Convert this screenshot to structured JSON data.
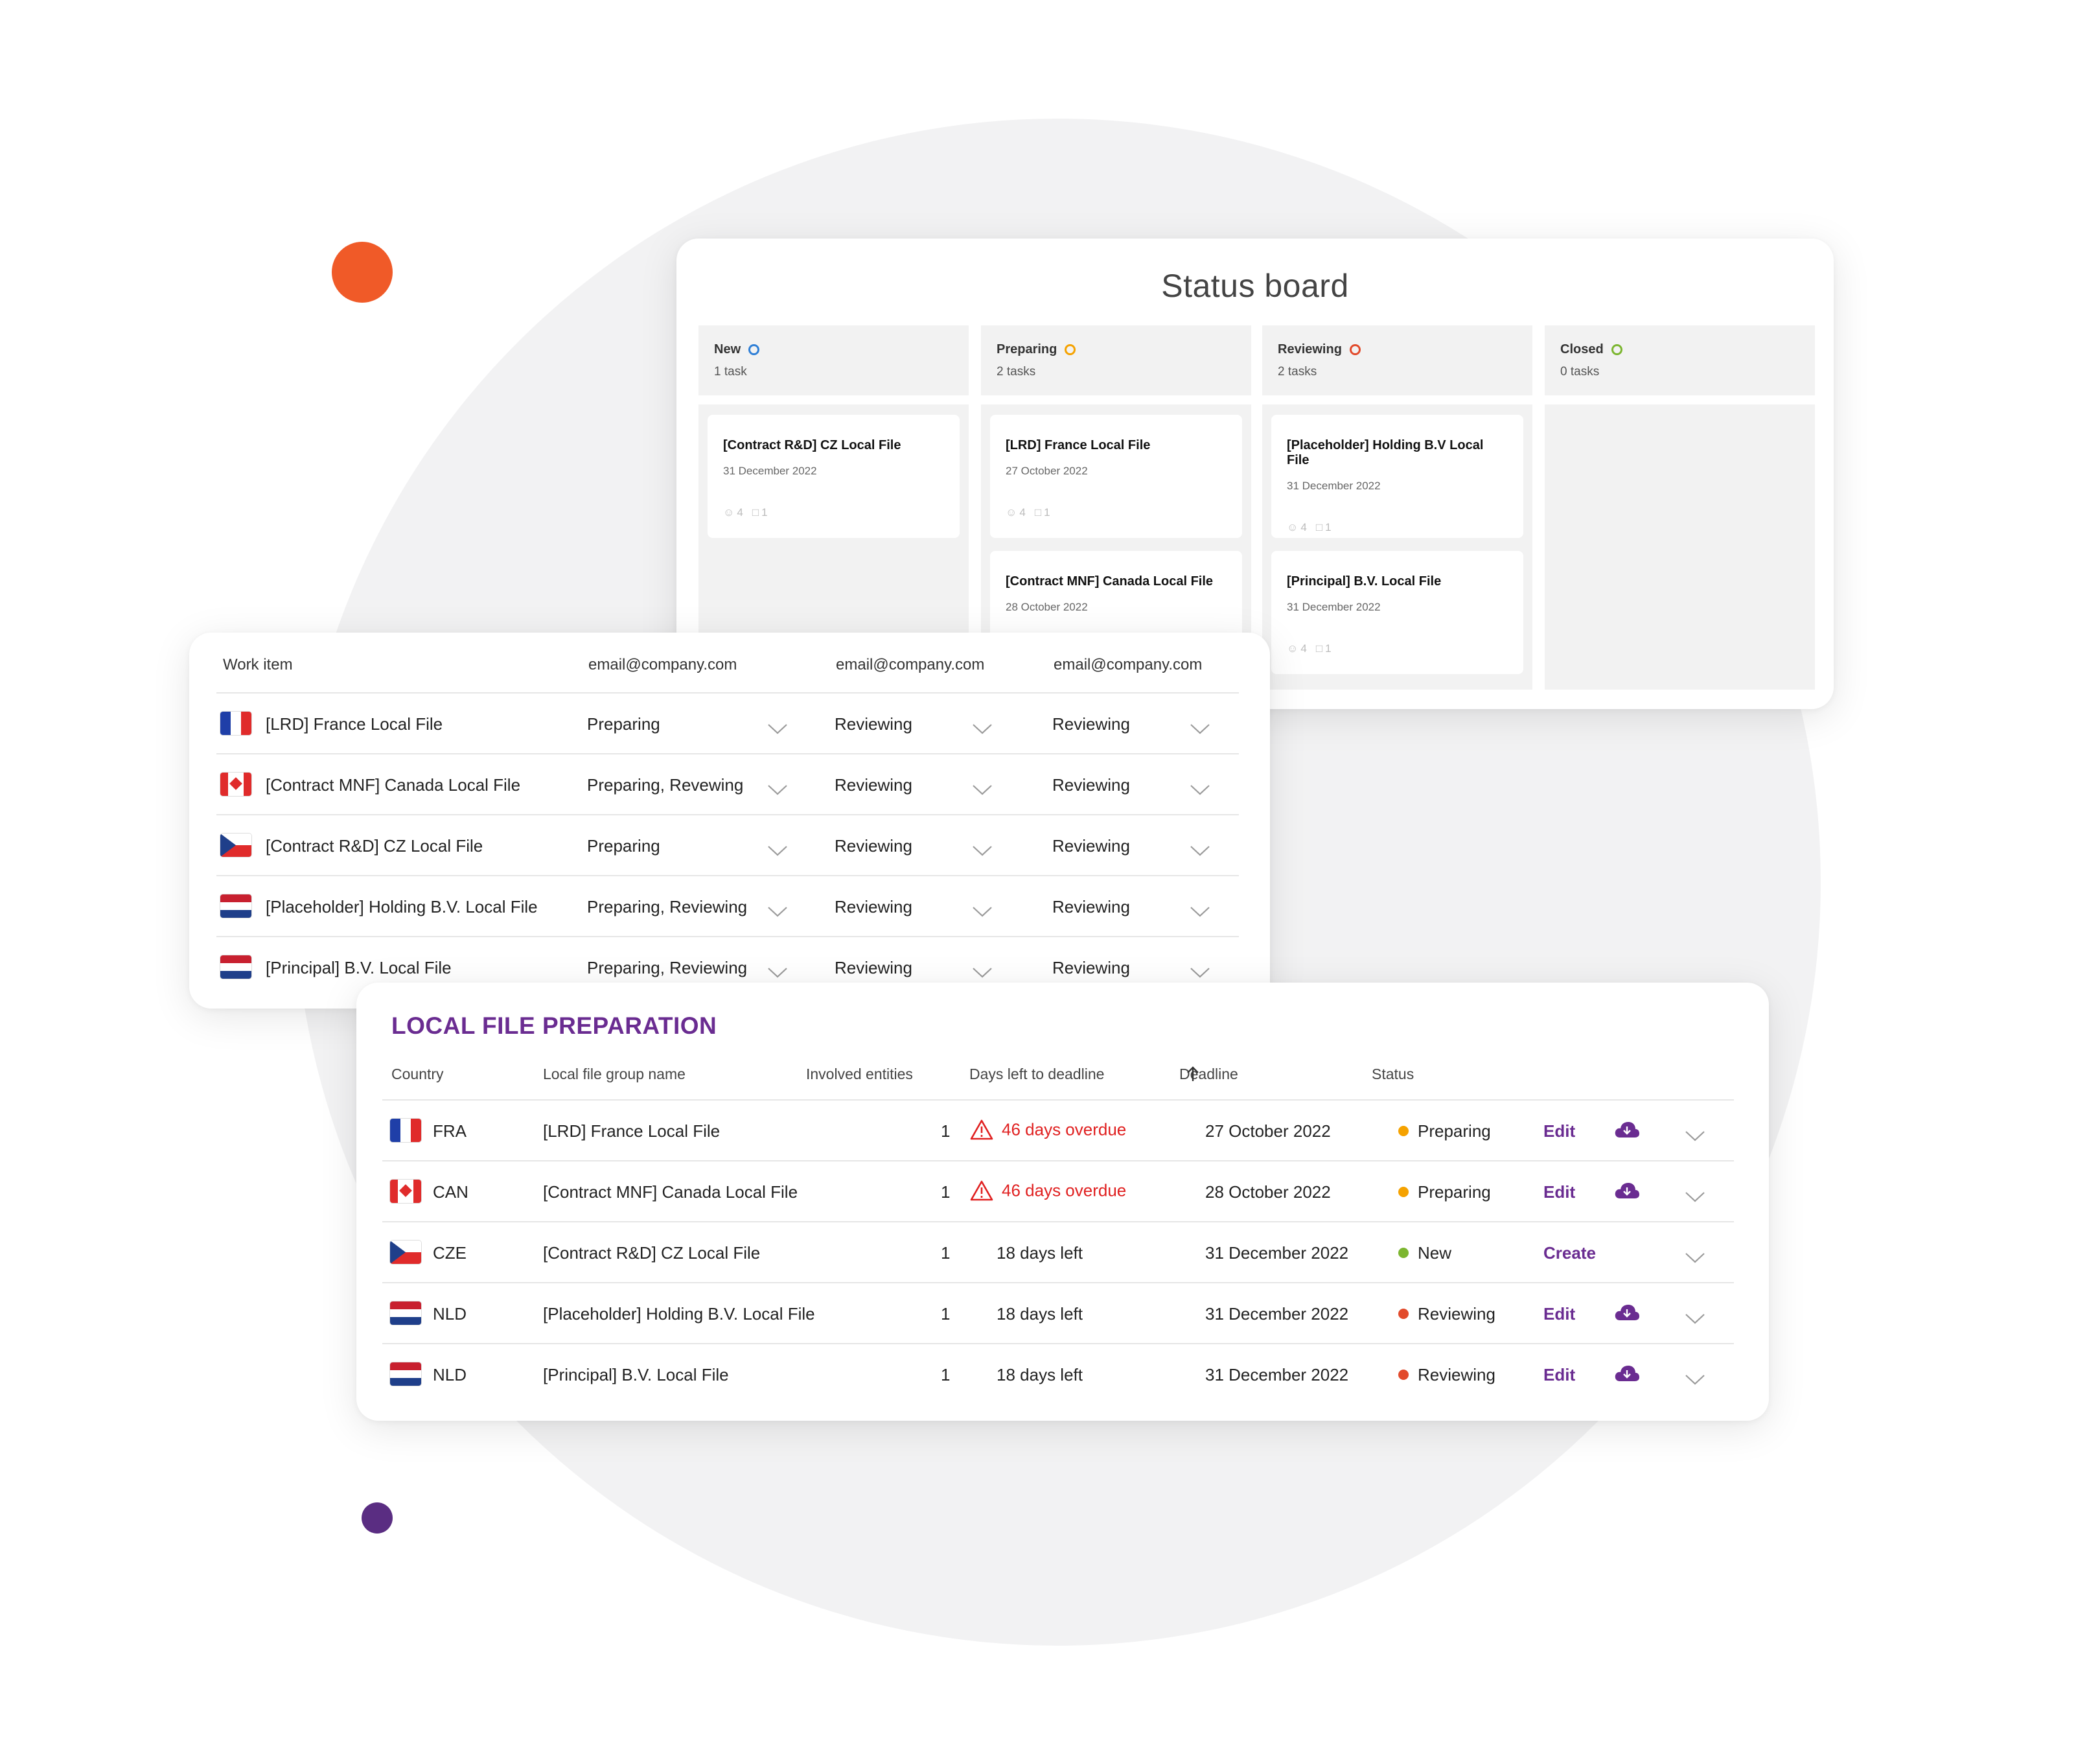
{
  "colors": {
    "accent_purple": "#6a2c91",
    "orange": "#f5a200",
    "red": "#e24a2b",
    "green": "#7cb630",
    "blue": "#2f7fd6",
    "overdue_red": "#e02020"
  },
  "status_board": {
    "title": "Status board",
    "columns": [
      {
        "name": "New",
        "count": "1 task",
        "ring_color": "#2f7fd6",
        "tasks": [
          {
            "title": "[Contract R&D] CZ Local File",
            "date": "31 December 2022",
            "people": "4",
            "files": "1"
          }
        ]
      },
      {
        "name": "Preparing",
        "count": "2 tasks",
        "ring_color": "#f5a200",
        "tasks": [
          {
            "title": "[LRD] France Local File",
            "date": "27 October 2022",
            "people": "4",
            "files": "1"
          },
          {
            "title": "[Contract MNF] Canada Local File",
            "date": "28 October 2022",
            "people": "",
            "files": ""
          }
        ]
      },
      {
        "name": "Reviewing",
        "count": "2 tasks",
        "ring_color": "#e24a2b",
        "tasks": [
          {
            "title": "[Placeholder] Holding B.V Local File",
            "date": "31 December 2022",
            "people": "4",
            "files": "1"
          },
          {
            "title": "[Principal] B.V. Local File",
            "date": "31 December 2022",
            "people": "4",
            "files": "1"
          }
        ]
      },
      {
        "name": "Closed",
        "count": "0 tasks",
        "ring_color": "#7cb630",
        "tasks": []
      }
    ]
  },
  "work_items": {
    "headers": [
      "Work item",
      "email@company.com",
      "email@company.com",
      "email@company.com"
    ],
    "rows": [
      {
        "flag": "france",
        "name": "[LRD] France Local File",
        "s1": "Preparing",
        "s2": "Reviewing",
        "s3": "Reviewing"
      },
      {
        "flag": "canada",
        "name": "[Contract MNF] Canada Local File",
        "s1": "Preparing, Revewing",
        "s2": "Reviewing",
        "s3": "Reviewing"
      },
      {
        "flag": "czech",
        "name": "[Contract R&D] CZ Local File",
        "s1": "Preparing",
        "s2": "Reviewing",
        "s3": "Reviewing"
      },
      {
        "flag": "netherlands",
        "name": "[Placeholder] Holding B.V. Local File",
        "s1": "Preparing, Reviewing",
        "s2": "Reviewing",
        "s3": "Reviewing"
      },
      {
        "flag": "netherlands",
        "name": "[Principal] B.V. Local File",
        "s1": "Preparing, Reviewing",
        "s2": "Reviewing",
        "s3": "Reviewing"
      }
    ]
  },
  "local_files": {
    "title": "LOCAL FILE PREPARATION",
    "headers": {
      "country": "Country",
      "group": "Local file group name",
      "entities": "Involved entities",
      "days": "Days left to deadline",
      "deadline": "Deadline",
      "status": "Status"
    },
    "rows": [
      {
        "flag": "france",
        "code": "FRA",
        "name": "[LRD] France Local File",
        "entities": "1",
        "days": "46 days overdue",
        "overdue": true,
        "deadline": "27 October 2022",
        "status": "Preparing",
        "status_color": "#f5a200",
        "action": "Edit",
        "download": true
      },
      {
        "flag": "canada",
        "code": "CAN",
        "name": "[Contract MNF] Canada Local File",
        "entities": "1",
        "days": "46 days overdue",
        "overdue": true,
        "deadline": "28 October 2022",
        "status": "Preparing",
        "status_color": "#f5a200",
        "action": "Edit",
        "download": true
      },
      {
        "flag": "czech",
        "code": "CZE",
        "name": "[Contract R&D] CZ Local File",
        "entities": "1",
        "days": "18 days left",
        "overdue": false,
        "deadline": "31 December 2022",
        "status": "New",
        "status_color": "#7cb630",
        "action": "Create",
        "download": false
      },
      {
        "flag": "netherlands",
        "code": "NLD",
        "name": "[Placeholder] Holding B.V. Local File",
        "entities": "1",
        "days": "18 days left",
        "overdue": false,
        "deadline": "31 December 2022",
        "status": "Reviewing",
        "status_color": "#e24a2b",
        "action": "Edit",
        "download": true
      },
      {
        "flag": "netherlands",
        "code": "NLD",
        "name": "[Principal] B.V. Local File",
        "entities": "1",
        "days": "18 days left",
        "overdue": false,
        "deadline": "31 December 2022",
        "status": "Reviewing",
        "status_color": "#e24a2b",
        "action": "Edit",
        "download": true
      }
    ]
  }
}
